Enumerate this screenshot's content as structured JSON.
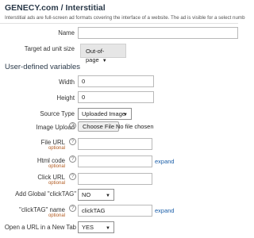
{
  "header": {
    "title": "GENECY.com / Interstitial",
    "description": "Interstitial ads are full-screen ad formats covering the interface of a website. The ad is visible for a select numb"
  },
  "fields": {
    "name": {
      "label": "Name",
      "value": ""
    },
    "target_ad_unit_size": {
      "label": "Target ad unit size",
      "value": "Out-of-page"
    }
  },
  "section": {
    "title": "User-defined variables"
  },
  "variables": {
    "width": {
      "label": "Width",
      "value": "0"
    },
    "height": {
      "label": "Height",
      "value": "0"
    },
    "source_type": {
      "label": "Source Type",
      "value": "Uploaded Image"
    },
    "image_upload": {
      "label": "Image Upload",
      "button": "Choose File",
      "status": "No file chosen"
    },
    "file_url": {
      "label": "File URL",
      "optional": "optional",
      "value": ""
    },
    "html_code": {
      "label": "Html code",
      "optional": "optional",
      "value": "",
      "expand": "expand"
    },
    "click_url": {
      "label": "Click URL",
      "optional": "optional",
      "value": ""
    },
    "add_global_clicktag": {
      "label": "Add Global \"clickTAG\"",
      "value": "NO"
    },
    "clicktag_name": {
      "label": "\"clickTAG\" name",
      "optional": "optional",
      "value": "clickTAG",
      "expand": "expand"
    },
    "open_new_tab": {
      "label": "Open a URL in a New Tab",
      "value": "YES"
    }
  },
  "icons": {
    "help": "?",
    "dropdown": "▼"
  }
}
